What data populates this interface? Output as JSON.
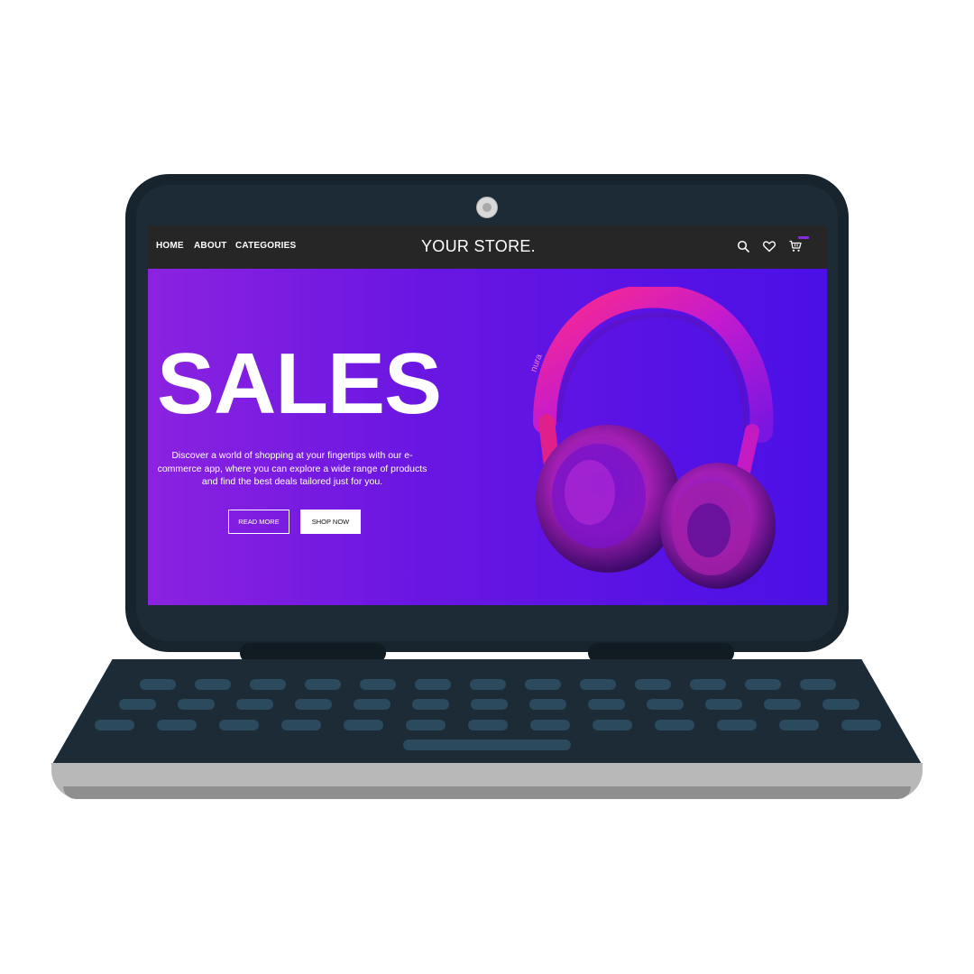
{
  "nav": {
    "links": [
      "HOME",
      "ABOUT",
      "CATEGORIES"
    ],
    "brand": "YOUR STORE.",
    "icons": [
      "search-icon",
      "heart-icon",
      "cart-icon"
    ]
  },
  "hero": {
    "title": "SALES",
    "description": "Discover a world of shopping at your fingertips with our e-commerce app, where you can explore a wide range of products and find the best deals tailored just for you.",
    "buttons": {
      "read_more": "READ MORE",
      "shop_now": "SHOP NOW"
    },
    "product_brand": "nura"
  },
  "colors": {
    "hero_gradient_start": "#8b22e0",
    "hero_gradient_end": "#4a10e6",
    "nav_background": "#262626",
    "laptop_body": "#1d2b37",
    "cart_badge": "#8a2be2"
  }
}
